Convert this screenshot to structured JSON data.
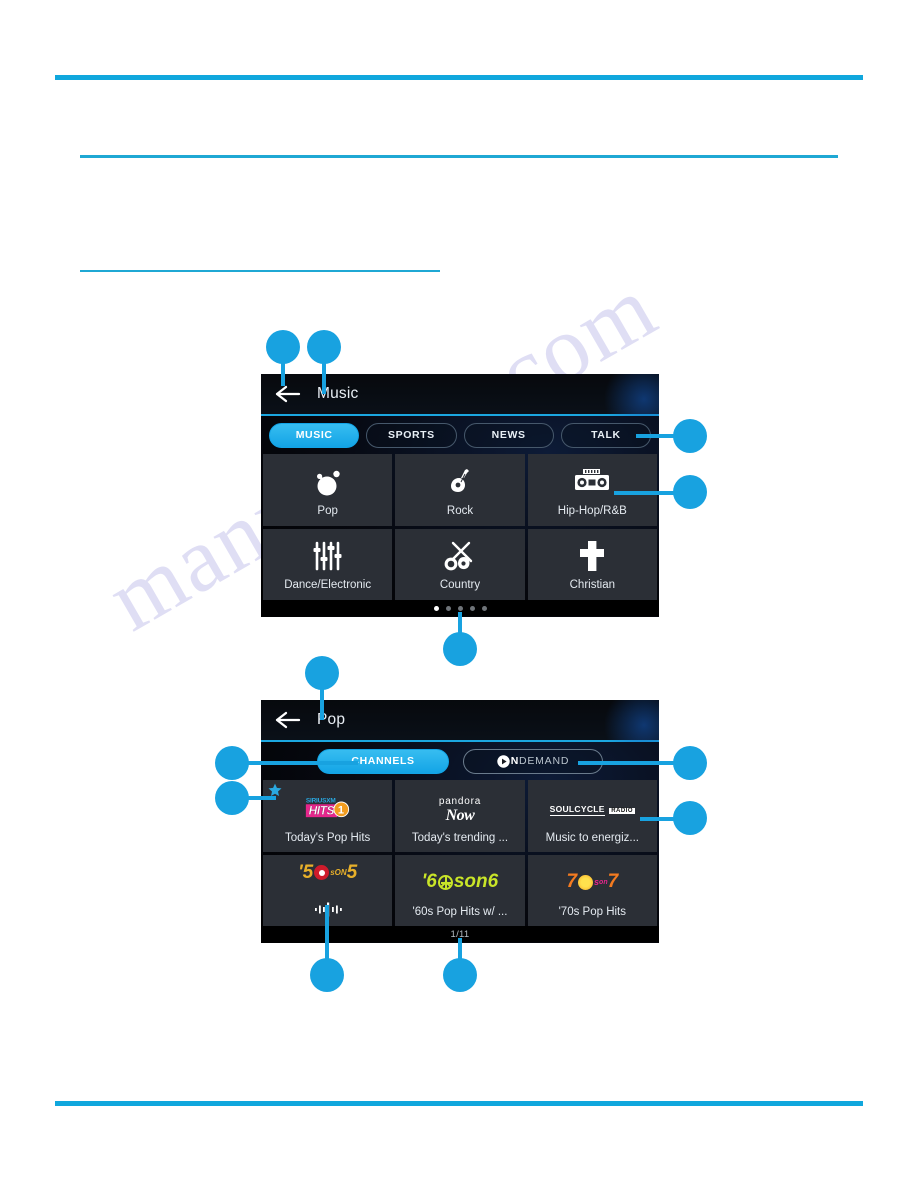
{
  "document": {
    "watermark": "manualslib.com",
    "rules": [
      "top-thick-divider",
      "mid-divider",
      "short-divider",
      "bottom-divider"
    ]
  },
  "screen_music": {
    "titlebar": {
      "title": "Music",
      "back_icon": "back-arrow-icon"
    },
    "category_tabs": [
      {
        "label": "MUSIC",
        "active": true
      },
      {
        "label": "SPORTS",
        "active": false
      },
      {
        "label": "NEWS",
        "active": false
      },
      {
        "label": "TALK",
        "active": false
      }
    ],
    "genre_tiles": [
      {
        "label": "Pop",
        "icon": "balloon-icon"
      },
      {
        "label": "Rock",
        "icon": "electric-guitar-icon"
      },
      {
        "label": "Hip-Hop/R&B",
        "icon": "boombox-icon"
      },
      {
        "label": "Dance/Electronic",
        "icon": "equalizer-sliders-icon"
      },
      {
        "label": "Country",
        "icon": "banjo-guitar-icon"
      },
      {
        "label": "Christian",
        "icon": "cross-icon"
      }
    ],
    "pager": {
      "total_dots": 5,
      "active_index": 0
    }
  },
  "screen_pop": {
    "titlebar": {
      "title": "Pop",
      "back_icon": "back-arrow-icon"
    },
    "source_tabs": [
      {
        "label": "CHANNELS",
        "active": true
      },
      {
        "label_bold": "ON",
        "label_rest": "DEMAND",
        "active": false
      }
    ],
    "channel_tiles": [
      {
        "label": "Today's Pop Hits",
        "logo": "siriusxm-hits-1-logo",
        "favorite": true,
        "now_playing": false
      },
      {
        "label": "Today's trending ...",
        "logo": "pandora-now-logo",
        "favorite": false,
        "now_playing": false
      },
      {
        "label": "Music to energiz...",
        "logo": "soulcycle-radio-logo",
        "favorite": false,
        "now_playing": false
      },
      {
        "label": "",
        "logo": "50s-on-5-logo",
        "favorite": false,
        "now_playing": true
      },
      {
        "label": "'60s Pop Hits w/ ...",
        "logo": "60s-on-6-logo",
        "favorite": false,
        "now_playing": false
      },
      {
        "label": "'70s Pop Hits",
        "logo": "70s-on-7-logo",
        "favorite": false,
        "now_playing": false
      }
    ],
    "logo_text": {
      "siriusxm_top": "SIRIUSXM",
      "siriusxm_hits": "HITS",
      "siriusxm_num": "1",
      "pandora_name": "pandora",
      "pandora_now": "Now",
      "soulcycle_name": "SOULCYCLE",
      "soulcycle_radio": "RADIO",
      "d50_a": "'5",
      "d50_b": "s",
      "d50_on": "ON",
      "d50_c": "5",
      "d60_a": "'6",
      "d60_b": "s",
      "d60_on": "on",
      "d60_c": "6",
      "d70_a": "7",
      "d70_b": "s",
      "d70_on": "on",
      "d70_c": "7"
    },
    "page_indicator": "1/11"
  },
  "callouts": [
    {
      "id": 1,
      "target": "back-arrow-music"
    },
    {
      "id": 2,
      "target": "title-music"
    },
    {
      "id": 3,
      "target": "category-tabs"
    },
    {
      "id": 4,
      "target": "genre-tile"
    },
    {
      "id": 5,
      "target": "pager-dots"
    },
    {
      "id": 6,
      "target": "title-pop"
    },
    {
      "id": 7,
      "target": "channels-tab"
    },
    {
      "id": 8,
      "target": "ondemand-tab"
    },
    {
      "id": 9,
      "target": "favorite-star"
    },
    {
      "id": 10,
      "target": "channel-tile"
    },
    {
      "id": 11,
      "target": "now-playing-indicator"
    },
    {
      "id": 12,
      "target": "page-indicator"
    }
  ],
  "colors": {
    "accent": "#18a2e0",
    "rule": "#10a7dd",
    "tile_bg": "#2b2f36",
    "screen_bg": "#000000",
    "watermark": "#b9b7e8"
  }
}
